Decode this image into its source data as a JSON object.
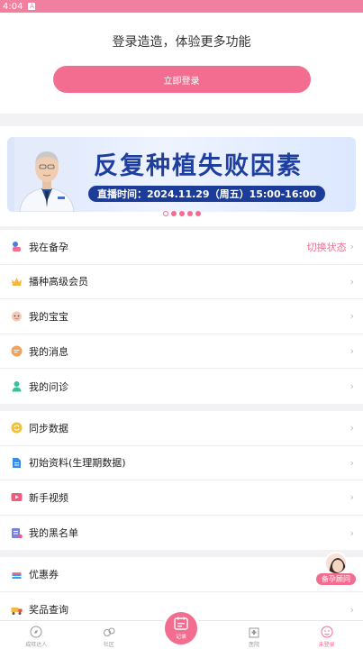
{
  "status_bar": {
    "time": "4:04",
    "sim": "A"
  },
  "login": {
    "prompt": "登录造造，体验更多功能",
    "button": "立即登录"
  },
  "banner": {
    "title": "反复种植失败因素",
    "time_text": "直播时间：2024.11.29（周五）15:00-16:00",
    "carousel": {
      "count": 5,
      "active": 1
    }
  },
  "menu_group_1": [
    {
      "label": "我在备孕",
      "extra": "切换状态",
      "icon": "pregnancy-prep-icon"
    },
    {
      "label": "播种高级会员",
      "extra": "",
      "icon": "premium-member-icon"
    },
    {
      "label": "我的宝宝",
      "extra": "",
      "icon": "baby-icon"
    },
    {
      "label": "我的消息",
      "extra": "",
      "icon": "message-icon"
    },
    {
      "label": "我的问诊",
      "extra": "",
      "icon": "consultation-icon"
    }
  ],
  "menu_group_2": [
    {
      "label": "同步数据",
      "icon": "sync-icon"
    },
    {
      "label": "初始资料(生理期数据)",
      "icon": "document-icon"
    },
    {
      "label": "新手视频",
      "icon": "video-icon"
    },
    {
      "label": "我的黑名单",
      "icon": "blacklist-icon"
    }
  ],
  "menu_group_3": [
    {
      "label": "优惠券",
      "icon": "coupon-icon"
    },
    {
      "label": "奖品查询",
      "icon": "prize-truck-icon"
    }
  ],
  "adviser": {
    "label": "备孕顾问"
  },
  "tabbar": [
    {
      "label": "成旺达人",
      "icon": "compass-icon"
    },
    {
      "label": "社区",
      "icon": "community-icon"
    },
    {
      "label": "记录",
      "icon": "record-icon"
    },
    {
      "label": "医院",
      "icon": "hospital-icon"
    },
    {
      "label": "未登录",
      "icon": "profile-face-icon"
    }
  ],
  "colors": {
    "accent": "#f26d8f",
    "status_bar": "#f07fa0",
    "banner_blue": "#1f3f9e"
  }
}
